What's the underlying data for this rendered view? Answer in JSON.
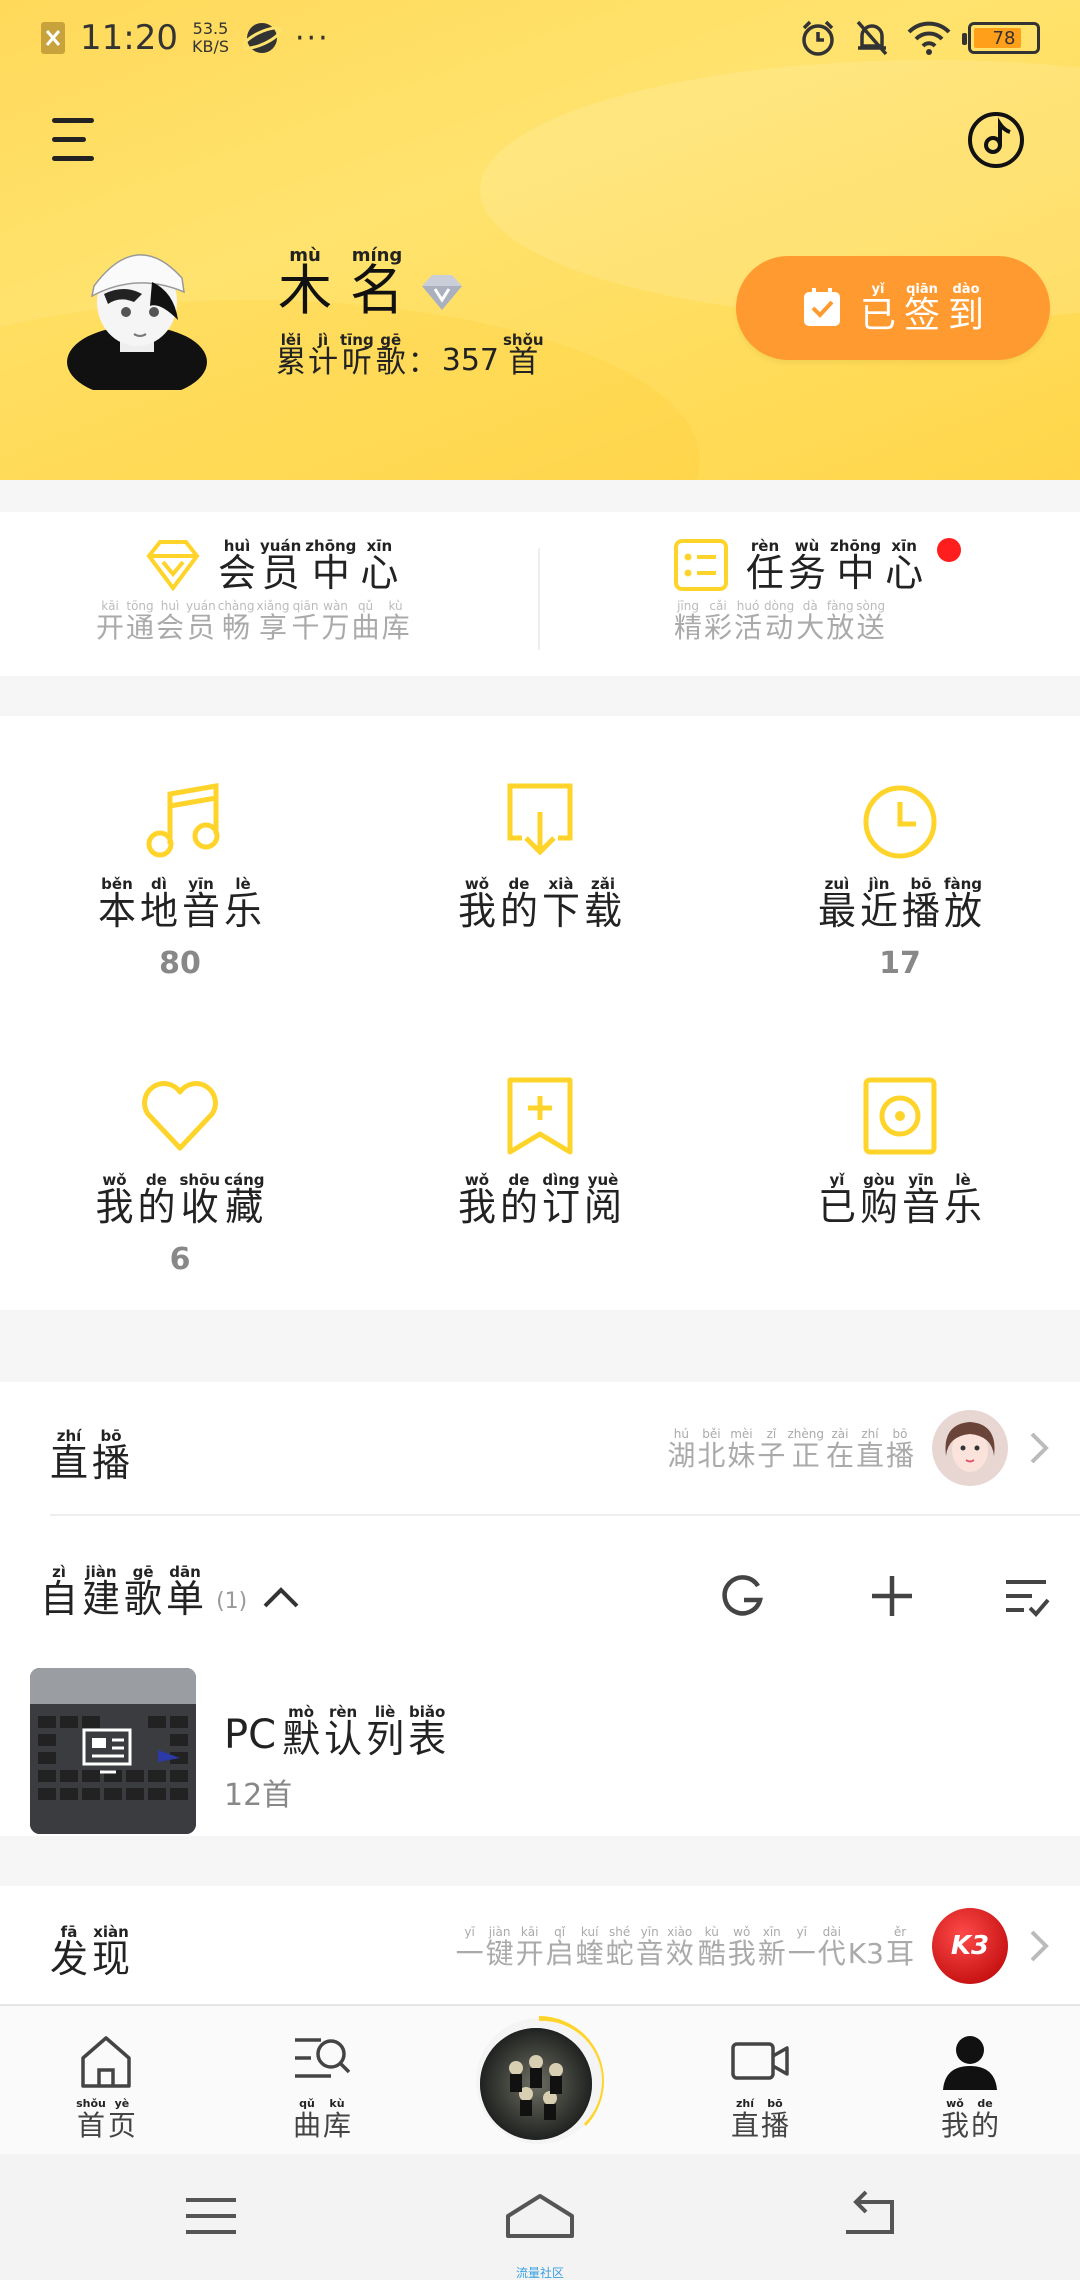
{
  "status_bar": {
    "time": "11:20",
    "speed_value": "53.5",
    "speed_unit": "KB/S",
    "more": "···",
    "battery_level": 78,
    "battery_text": "78"
  },
  "profile": {
    "name": [
      {
        "ch": "木",
        "py": "mù"
      },
      {
        "ch": "名",
        "py": "míng"
      }
    ],
    "listen_label": [
      {
        "ch": "累",
        "py": "lěi"
      },
      {
        "ch": "计",
        "py": "jì"
      },
      {
        "ch": "听",
        "py": "tīng"
      },
      {
        "ch": "歌",
        "py": "gē"
      },
      {
        "ch": "：",
        "py": ""
      }
    ],
    "listen_count": "357",
    "listen_unit": {
      "ch": "首",
      "py": "shǒu"
    },
    "signin": [
      {
        "ch": "已",
        "py": "yǐ"
      },
      {
        "ch": "签",
        "py": "qiān"
      },
      {
        "ch": "到",
        "py": "dào"
      }
    ]
  },
  "vip_center": {
    "title": [
      {
        "ch": "会",
        "py": "huì"
      },
      {
        "ch": "员",
        "py": "yuán"
      },
      {
        "ch": "中",
        "py": "zhōng"
      },
      {
        "ch": "心",
        "py": "xīn"
      }
    ],
    "sub": [
      {
        "ch": "开",
        "py": "kāi"
      },
      {
        "ch": "通",
        "py": "tōng"
      },
      {
        "ch": "会",
        "py": "huì"
      },
      {
        "ch": "员",
        "py": "yuán"
      },
      {
        "ch": "畅",
        "py": "chàng"
      },
      {
        "ch": "享",
        "py": "xiǎng"
      },
      {
        "ch": "千",
        "py": "qiān"
      },
      {
        "ch": "万",
        "py": "wàn"
      },
      {
        "ch": "曲",
        "py": "qǔ"
      },
      {
        "ch": "库",
        "py": "kù"
      }
    ]
  },
  "task_center": {
    "title": [
      {
        "ch": "任",
        "py": "rèn"
      },
      {
        "ch": "务",
        "py": "wù"
      },
      {
        "ch": "中",
        "py": "zhōng"
      },
      {
        "ch": "心",
        "py": "xīn"
      }
    ],
    "sub": [
      {
        "ch": "精",
        "py": "jīng"
      },
      {
        "ch": "彩",
        "py": "cǎi"
      },
      {
        "ch": "活",
        "py": "huó"
      },
      {
        "ch": "动",
        "py": "dòng"
      },
      {
        "ch": "大",
        "py": "dà"
      },
      {
        "ch": "放",
        "py": "fàng"
      },
      {
        "ch": "送",
        "py": "sòng"
      }
    ]
  },
  "grid": [
    {
      "label": [
        {
          "ch": "本",
          "py": "běn"
        },
        {
          "ch": "地",
          "py": "dì"
        },
        {
          "ch": "音",
          "py": "yīn"
        },
        {
          "ch": "乐",
          "py": "lè"
        }
      ],
      "count": "80",
      "icon": "music-note-icon"
    },
    {
      "label": [
        {
          "ch": "我",
          "py": "wǒ"
        },
        {
          "ch": "的",
          "py": "de"
        },
        {
          "ch": "下",
          "py": "xià"
        },
        {
          "ch": "载",
          "py": "zǎi"
        }
      ],
      "count": "",
      "icon": "download-icon"
    },
    {
      "label": [
        {
          "ch": "最",
          "py": "zuì"
        },
        {
          "ch": "近",
          "py": "jìn"
        },
        {
          "ch": "播",
          "py": "bō"
        },
        {
          "ch": "放",
          "py": "fàng"
        }
      ],
      "count": "17",
      "icon": "clock-icon"
    },
    {
      "label": [
        {
          "ch": "我",
          "py": "wǒ"
        },
        {
          "ch": "的",
          "py": "de"
        },
        {
          "ch": "收",
          "py": "shōu"
        },
        {
          "ch": "藏",
          "py": "cáng"
        }
      ],
      "count": "6",
      "icon": "heart-icon"
    },
    {
      "label": [
        {
          "ch": "我",
          "py": "wǒ"
        },
        {
          "ch": "的",
          "py": "de"
        },
        {
          "ch": "订",
          "py": "dìng"
        },
        {
          "ch": "阅",
          "py": "yuè"
        }
      ],
      "count": "",
      "icon": "subscribe-icon"
    },
    {
      "label": [
        {
          "ch": "已",
          "py": "yǐ"
        },
        {
          "ch": "购",
          "py": "gòu"
        },
        {
          "ch": "音",
          "py": "yīn"
        },
        {
          "ch": "乐",
          "py": "lè"
        }
      ],
      "count": "",
      "icon": "purchased-music-icon"
    }
  ],
  "live": {
    "title": [
      {
        "ch": "直",
        "py": "zhí"
      },
      {
        "ch": "播",
        "py": "bō"
      }
    ],
    "hint": [
      {
        "ch": "湖",
        "py": "hú"
      },
      {
        "ch": "北",
        "py": "běi"
      },
      {
        "ch": "妹",
        "py": "mèi"
      },
      {
        "ch": "子",
        "py": "zǐ"
      },
      {
        "ch": "正",
        "py": "zhèng"
      },
      {
        "ch": "在",
        "py": "zài"
      },
      {
        "ch": "直",
        "py": "zhí"
      },
      {
        "ch": "播",
        "py": "bō"
      }
    ]
  },
  "playlists": {
    "title": [
      {
        "ch": "自",
        "py": "zì"
      },
      {
        "ch": "建",
        "py": "jiàn"
      },
      {
        "ch": "歌",
        "py": "gē"
      },
      {
        "ch": "单",
        "py": "dān"
      }
    ],
    "count": "(1)",
    "items": [
      {
        "prefix": "PC",
        "name": [
          {
            "ch": "默",
            "py": "mò"
          },
          {
            "ch": "认",
            "py": "rèn"
          },
          {
            "ch": "列",
            "py": "liè"
          },
          {
            "ch": "表",
            "py": "biǎo"
          }
        ],
        "sub": "12首"
      }
    ]
  },
  "discover": {
    "title": [
      {
        "ch": "发",
        "py": "fā"
      },
      {
        "ch": "现",
        "py": "xiàn"
      }
    ],
    "hint": [
      {
        "ch": "一",
        "py": "yī"
      },
      {
        "ch": "键",
        "py": "jiàn"
      },
      {
        "ch": "开",
        "py": "kāi"
      },
      {
        "ch": "启",
        "py": "qǐ"
      },
      {
        "ch": "蝰",
        "py": "kuí"
      },
      {
        "ch": "蛇",
        "py": "shé"
      },
      {
        "ch": "音",
        "py": "yīn"
      },
      {
        "ch": "效",
        "py": "xiào"
      },
      {
        "ch": " ",
        "py": ""
      },
      {
        "ch": "酷",
        "py": "kù"
      },
      {
        "ch": "我",
        "py": "wǒ"
      },
      {
        "ch": "新",
        "py": "xīn"
      },
      {
        "ch": "一",
        "py": "yī"
      },
      {
        "ch": "代",
        "py": "dài"
      },
      {
        "ch": "K3",
        "py": ""
      },
      {
        "ch": "耳",
        "py": "ěr"
      }
    ],
    "badge": "K3"
  },
  "nav": [
    {
      "label": [
        {
          "ch": "首",
          "py": "shǒu"
        },
        {
          "ch": "页",
          "py": "yè"
        }
      ],
      "icon": "home-icon"
    },
    {
      "label": [
        {
          "ch": "曲",
          "py": "qǔ"
        },
        {
          "ch": "库",
          "py": "kù"
        }
      ],
      "icon": "library-search-icon"
    },
    {
      "label": [
        {
          "ch": "直",
          "py": "zhí"
        },
        {
          "ch": "播",
          "py": "bō"
        }
      ],
      "icon": "video-camera-icon"
    },
    {
      "label": [
        {
          "ch": "我",
          "py": "wǒ"
        },
        {
          "ch": "的",
          "py": "de"
        }
      ],
      "icon": "user-icon"
    }
  ],
  "system_bar": {
    "tag": "流量社区"
  },
  "colors": {
    "accent": "#ffd740",
    "icon_yellow": "#ffd42a",
    "signin": "#ff9a30",
    "red_dot": "#ff1e1e"
  }
}
